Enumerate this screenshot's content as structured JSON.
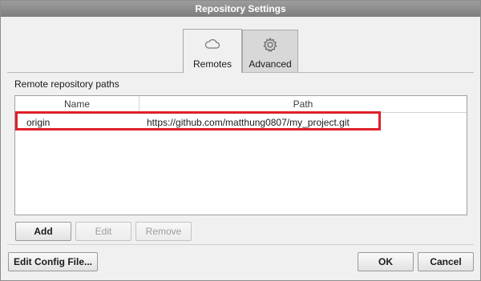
{
  "window": {
    "title": "Repository Settings"
  },
  "tabs": [
    {
      "label": "Remotes",
      "icon": "cloud-icon",
      "active": true
    },
    {
      "label": "Advanced",
      "icon": "gear-icon",
      "active": false
    }
  ],
  "remotes": {
    "section_label": "Remote repository paths",
    "columns": {
      "name": "Name",
      "path": "Path"
    },
    "rows": [
      {
        "name": "origin",
        "path": "https://github.com/matthung0807/my_project.git"
      }
    ],
    "buttons": {
      "add": "Add",
      "edit": "Edit",
      "remove": "Remove"
    }
  },
  "footer": {
    "edit_config": "Edit Config File...",
    "ok": "OK",
    "cancel": "Cancel"
  },
  "colors": {
    "titlebar": "#8a8a8a",
    "highlight": "#e0202a",
    "window_bg": "#f0f0f0"
  }
}
